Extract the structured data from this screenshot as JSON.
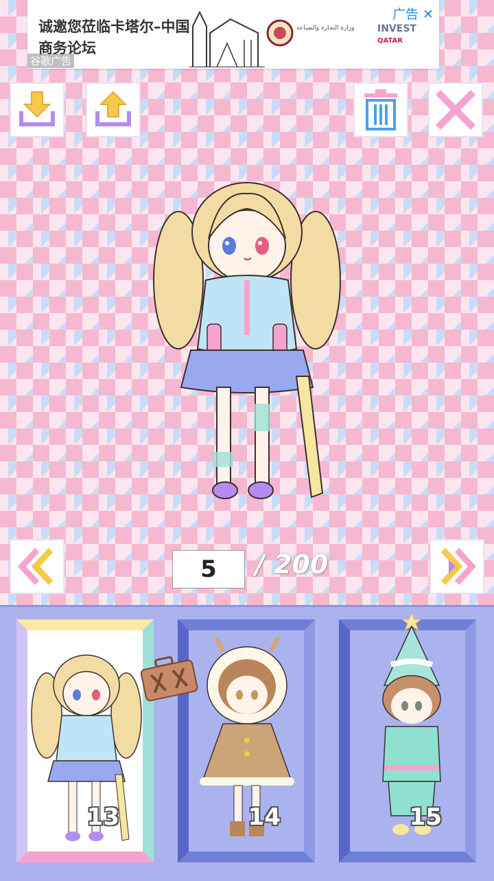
{
  "ad": {
    "headline": "诚邀您莅临卡塔尔–中国商务论坛",
    "label": "谷歌广告",
    "ad_tag": "广告",
    "brand": "INVEST",
    "brand_sub": "QATAR",
    "ministry_text": "وزارة التجارة والصناعة"
  },
  "pager": {
    "current": "5",
    "total": "/ 200"
  },
  "cards": [
    {
      "number": "13"
    },
    {
      "number": "14"
    },
    {
      "number": "15"
    }
  ],
  "colors": {
    "tray": "#aab3ee",
    "accent_yellow": "#f7c948",
    "accent_purple": "#b48cf0",
    "delete_blue": "#4aa3e6",
    "close_pink": "#f7a3cf"
  }
}
